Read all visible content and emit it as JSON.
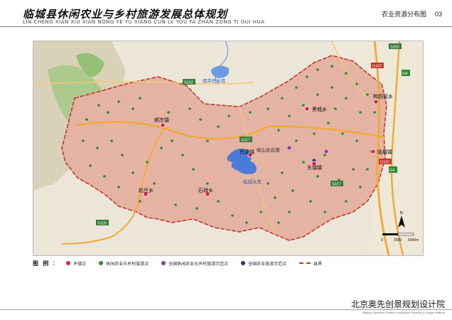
{
  "header": {
    "title": "临城县休闲农业与乡村旅游发展总体规划",
    "subtitle": "LIN CHENG XIAN XIU XIAN NONG YE YU XIANG CUN LV YOU FA ZHAN ZONG TI GUI HUA",
    "section": "农业资源分布图",
    "page_number": "03"
  },
  "map": {
    "towns": [
      {
        "name": "郝庄镇"
      },
      {
        "name": "西竖镇"
      },
      {
        "name": "黑城乡"
      },
      {
        "name": "东镇镇"
      },
      {
        "name": "鸭鸽营乡"
      },
      {
        "name": "临城镇"
      },
      {
        "name": "赵庄乡"
      },
      {
        "name": "石城乡"
      }
    ],
    "places": {
      "reservoir_nanping": "南平旺水库",
      "reservoir_lincheng": "临城水库",
      "scenic_qishan": "岐山台云洞"
    },
    "roads": [
      "S202",
      "S327",
      "G107",
      "G4",
      "S393",
      "S328"
    ],
    "scale_labels": [
      "0",
      "2500",
      "5000m"
    ],
    "north_label": "N",
    "colors": {
      "county_fill": "#e4b0a0",
      "county_border": "#c0392b",
      "town_point": "#d6264b",
      "leisure_point": "#2e8b2e",
      "national_leisure_point": "#9b30b8",
      "national_agri_point": "#22309e",
      "water": "#4a7bd9",
      "highway": "#f2a93b"
    }
  },
  "legend": {
    "title": "图 例 :",
    "items": [
      {
        "label": "乡镇点",
        "color": "#d6264b",
        "icon": "red-dot-icon"
      },
      {
        "label": "休闲农业与乡村旅游点",
        "color": "#2e8b2e",
        "icon": "green-dot-icon"
      },
      {
        "label": "全国休闲农业与乡村旅游示范点",
        "color": "#9b30b8",
        "icon": "purple-dot-icon"
      },
      {
        "label": "全国农业旅游示范点",
        "color": "#22309e",
        "icon": "blue-dot-icon"
      },
      {
        "label": "县界",
        "color": "#c0392b",
        "icon": "boundary-line-icon"
      }
    ]
  },
  "footer": {
    "company": "北京奥先创景规划设计院",
    "company_en": "Beijing Olymxian Creative Landscape Planning & Design Institute"
  }
}
